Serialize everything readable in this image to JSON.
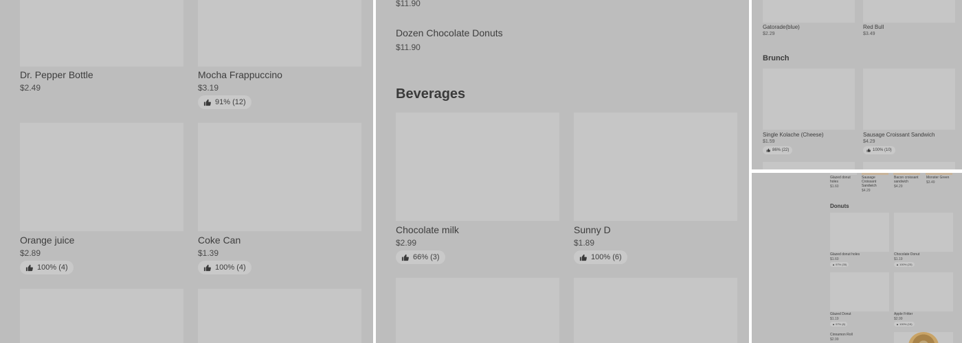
{
  "panel1": {
    "items": [
      {
        "name": "Dr. Pepper Bottle",
        "price": "$2.49",
        "rating": ""
      },
      {
        "name": "Mocha Frappuccino",
        "price": "$3.19",
        "rating": "91% (12)"
      },
      {
        "name": "Orange juice",
        "price": "$2.89",
        "rating": "100% (4)"
      },
      {
        "name": "Coke Can",
        "price": "$1.39",
        "rating": "100% (4)"
      }
    ]
  },
  "panel2": {
    "top_price": "$11.90",
    "dozen": {
      "name": "Dozen Chocolate Donuts",
      "price": "$11.90"
    },
    "section_title": "Beverages",
    "items": [
      {
        "name": "Chocolate milk",
        "price": "$2.99",
        "rating": "66% (3)"
      },
      {
        "name": "Sunny D",
        "price": "$1.89",
        "rating": "100% (6)"
      }
    ]
  },
  "panel3": {
    "items": [
      {
        "name": "Gatorade(blue)",
        "price": "$2.29"
      },
      {
        "name": "Red Bull",
        "price": "$3.49"
      }
    ],
    "section_title": "Brunch",
    "brunch": [
      {
        "name": "Single Kolache (Cheese)",
        "price": "$1.59",
        "rating": "86% (22)"
      },
      {
        "name": "Sausage Croissant Sandwich",
        "price": "$4.29",
        "rating": "100% (10)"
      }
    ]
  },
  "panel4": {
    "top": [
      {
        "name": "Glazed donut holes",
        "price": "$1.60"
      },
      {
        "name": "Sausage Croissant Sandwich",
        "price": "$4.29"
      },
      {
        "name": "Bacon croissant sandwich",
        "price": "$4.29"
      },
      {
        "name": "Monster Green",
        "price": "$3.49"
      }
    ],
    "section_title": "Donuts",
    "grid": [
      {
        "name": "Glazed donut holes",
        "price": "$1.60",
        "rating": "97% (35)"
      },
      {
        "name": "Chocolate Donut",
        "price": "$1.19",
        "rating": "100% (23)"
      },
      {
        "name": "Glazed Donut",
        "price": "$1.19",
        "rating": "97% (8)"
      },
      {
        "name": "Apple Fritter",
        "price": "$2.99",
        "rating": "100% (15)"
      },
      {
        "name": "Cinnamon Roll",
        "price": "$2.99",
        "rating": ""
      }
    ]
  },
  "colors": {
    "overlay": "#bdbdbd",
    "image_placeholder": "#c6c6c6",
    "rating_chip": "#c9c9c9"
  },
  "icons": {
    "rating": "thumbs-up-icon"
  }
}
